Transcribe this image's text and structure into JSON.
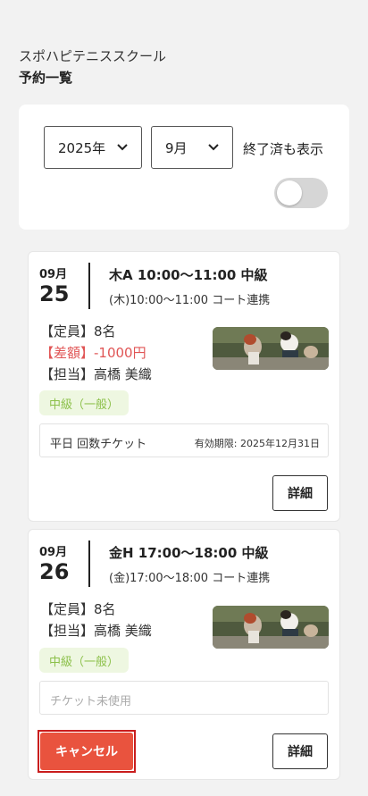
{
  "header": {
    "school_name": "スポハピテニススクール",
    "title": "予約一覧"
  },
  "filters": {
    "year": "2025年",
    "month": "9月",
    "show_completed_label": "終了済も表示",
    "show_completed": false
  },
  "reservations": [
    {
      "month": "09月",
      "day": "25",
      "title": "木A 10:00〜11:00 中級",
      "subtitle": "(木)10:00〜11:00 コート連携",
      "capacity": "【定員】8名",
      "price_diff": "【差額】-1000円",
      "instructor": "【担当】高橋 美織",
      "level": "中級（一般）",
      "ticket_name": "平日 回数チケット",
      "ticket_expiry": "有効期限: 2025年12月31日",
      "detail_label": "詳細"
    },
    {
      "month": "09月",
      "day": "26",
      "title": "金H 17:00〜18:00 中級",
      "subtitle": "(金)17:00〜18:00 コート連携",
      "capacity": "【定員】8名",
      "instructor": "【担当】高橋 美織",
      "level": "中級（一般）",
      "ticket_empty": "チケット未使用",
      "cancel_label": "キャンセル",
      "detail_label": "詳細"
    }
  ],
  "colors": {
    "accent_red": "#e9533e",
    "highlight_outline": "#c91d1d",
    "level_green": "#8cc04a",
    "level_bg": "#eef7e1",
    "price_red": "#e05555"
  }
}
